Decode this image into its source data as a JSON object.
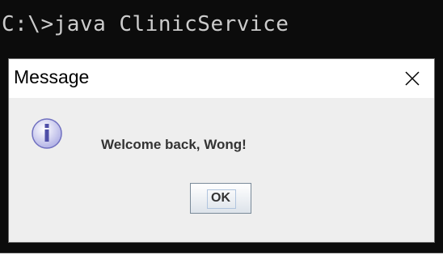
{
  "console": {
    "command_line": "C:\\>java ClinicService"
  },
  "dialog": {
    "title": "Message",
    "close_icon": "close-icon",
    "info_icon": "information-icon",
    "message": "Welcome back, Wong!",
    "ok_label": "OK"
  },
  "colors": {
    "console_background": "#0c0c0c",
    "console_text": "#cccccc",
    "dialog_background": "#eeeeee",
    "title_bar_background": "#ffffff",
    "info_icon_fill": "#b3b3e6",
    "info_icon_glyph": "#4f4fa8"
  }
}
